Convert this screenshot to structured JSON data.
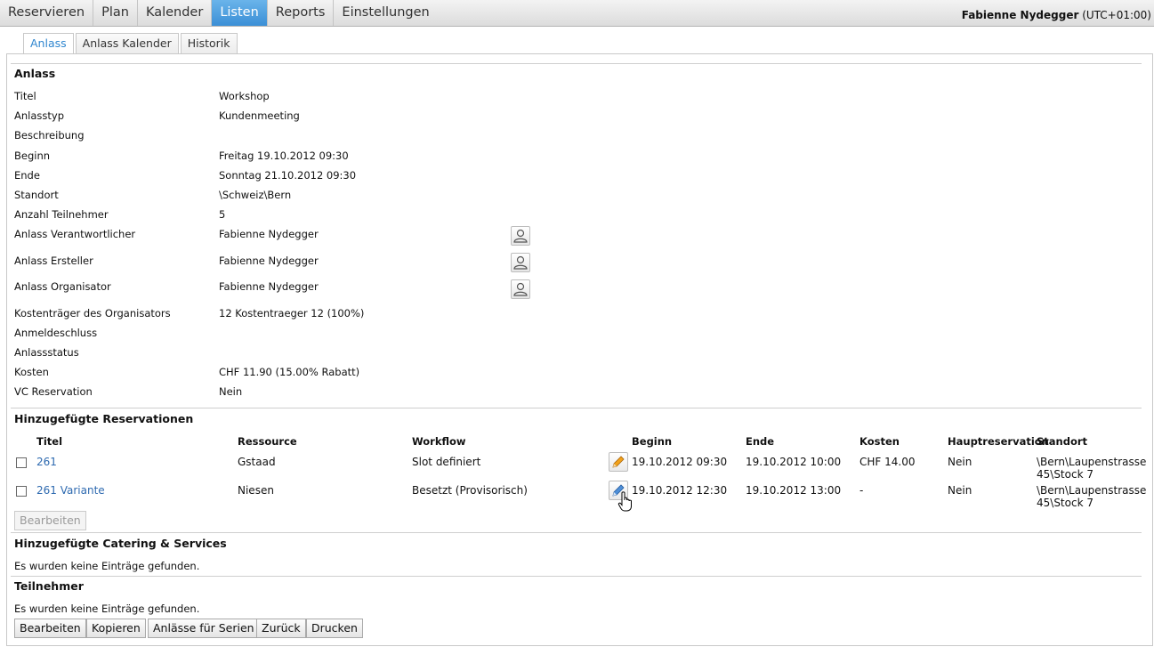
{
  "menu": {
    "items": [
      "Reservieren",
      "Plan",
      "Kalender",
      "Listen",
      "Reports",
      "Einstellungen"
    ],
    "active": "Listen"
  },
  "user": {
    "name": "Fabienne Nydegger",
    "tz": "(UTC+01:00)"
  },
  "tabs": [
    "Anlass",
    "Anlass Kalender",
    "Historik"
  ],
  "anlass": {
    "heading": "Anlass",
    "titel_label": "Titel",
    "titel_value": "Workshop",
    "typ_label": "Anlasstyp",
    "typ_value": "Kundenmeeting",
    "beschreibung_label": "Beschreibung",
    "beginn_label": "Beginn",
    "beginn_value": "Freitag 19.10.2012 09:30",
    "ende_label": "Ende",
    "ende_value": "Sonntag 21.10.2012 09:30",
    "standort_label": "Standort",
    "standort_value": "\\Schweiz\\Bern",
    "teilnehmer_label": "Anzahl Teilnehmer",
    "teilnehmer_value": "5",
    "verantwortlicher_label": "Anlass Verantwortlicher",
    "verantwortlicher_value": "Fabienne Nydegger",
    "ersteller_label": "Anlass Ersteller",
    "ersteller_value": "Fabienne Nydegger",
    "organisator_label": "Anlass Organisator",
    "organisator_value": "Fabienne Nydegger",
    "kostentraeger_label": "Kostenträger des Organisators",
    "kostentraeger_value": "12 Kostentraeger 12 (100%)",
    "anmeldeschluss_label": "Anmeldeschluss",
    "status_label": "Anlassstatus",
    "kosten_label": "Kosten",
    "kosten_value": "CHF 11.90 (15.00% Rabatt)",
    "vc_label": "VC Reservation",
    "vc_value": "Nein"
  },
  "reservationen": {
    "heading": "Hinzugefügte Reservationen",
    "columns": [
      "Titel",
      "Ressource",
      "Workflow",
      "Beginn",
      "Ende",
      "Kosten",
      "Hauptreservation",
      "Standort"
    ],
    "rows": [
      {
        "titel": "261",
        "ressource": "Gstaad",
        "workflow": "Slot definiert",
        "beginn": "19.10.2012 09:30",
        "ende": "19.10.2012 10:00",
        "kosten": "CHF 14.00",
        "haupt": "Nein",
        "standort1": "\\Bern\\Laupenstrasse",
        "standort2": "45\\Stock 7"
      },
      {
        "titel": "261 Variante",
        "ressource": "Niesen",
        "workflow": "Besetzt (Provisorisch)",
        "beginn": "19.10.2012 12:30",
        "ende": "19.10.2012 13:00",
        "kosten": "-",
        "haupt": "Nein",
        "standort1": "\\Bern\\Laupenstrasse",
        "standort2": "45\\Stock 7"
      }
    ],
    "bearbeiten": "Bearbeiten"
  },
  "catering": {
    "heading": "Hinzugefügte Catering & Services",
    "empty": "Es wurden keine Einträge gefunden."
  },
  "teilnehmer": {
    "heading": "Teilnehmer",
    "empty": "Es wurden keine Einträge gefunden."
  },
  "actions": [
    "Bearbeiten",
    "Kopieren",
    "Anlässe für Serien",
    "Zurück",
    "Drucken"
  ]
}
